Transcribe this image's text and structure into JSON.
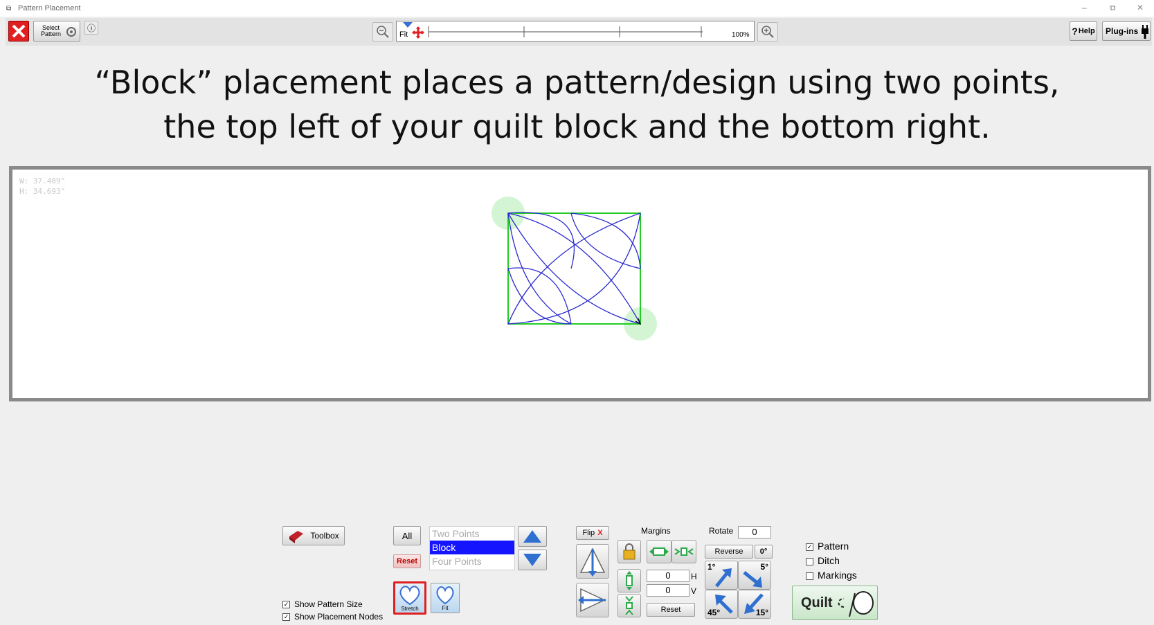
{
  "window": {
    "title": "Pattern Placement",
    "minimize": "–",
    "restore": "⧉",
    "close": "✕"
  },
  "toolbar": {
    "select_pattern_label_1": "Select",
    "select_pattern_label_2": "Pattern",
    "info_label": "ⓘ",
    "zoom_fit_label": "Fit",
    "zoom_level": "100%",
    "help_label": "Help",
    "help_prefix": "?",
    "plugins_label": "Plug-ins"
  },
  "heading": {
    "line1": "“Block” placement places a pattern/design using two points,",
    "line2": "the top left of your quilt block and the bottom right."
  },
  "canvas": {
    "width_readout": "W: 37.489\"",
    "height_readout": "H: 34.693\""
  },
  "controls": {
    "toolbox_label": "Toolbox",
    "all_label": "All",
    "reset_label": "Reset",
    "placement_options": [
      "Two Points",
      "Block",
      "Four Points"
    ],
    "selected_placement": "Block",
    "stretch_label": "Stretch",
    "fit_label": "Fit",
    "show_pattern_size": "Show Pattern Size",
    "show_placement_nodes": "Show Placement Nodes",
    "flip_label": "Flip",
    "flip_x": "X",
    "margins_label": "Margins",
    "margin_h_value": "0",
    "margin_h_unit": "H",
    "margin_v_value": "0",
    "margin_v_unit": "V",
    "margins_reset": "Reset",
    "rotate_label": "Rotate",
    "rotate_value": "0",
    "reverse_label": "Reverse",
    "zero_deg": "0°",
    "rot_1": "1°",
    "rot_5": "5°",
    "rot_45": "45°",
    "rot_15": "15°",
    "layer_pattern": "Pattern",
    "layer_ditch": "Ditch",
    "layer_markings": "Markings",
    "quilt_label": "Quilt"
  },
  "colors": {
    "accent_blue": "#1414ff",
    "pattern_stroke": "#2a2ad0",
    "block_outline": "#22cc22",
    "node_fill": "#c9f2c9",
    "close_red": "#e02020"
  }
}
